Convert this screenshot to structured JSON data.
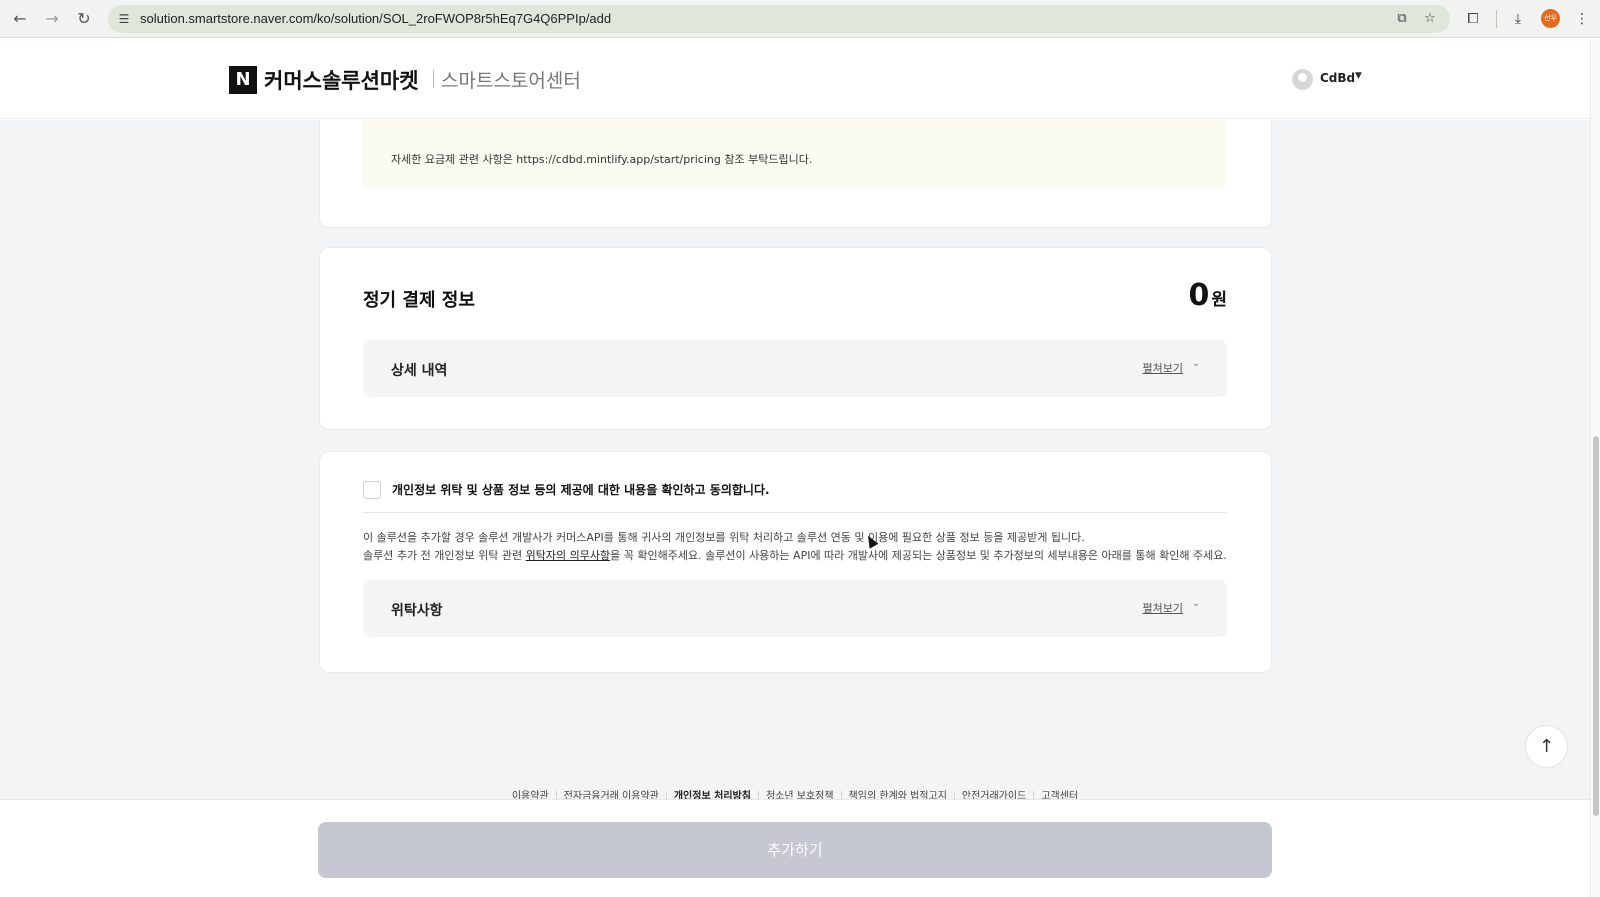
{
  "browser": {
    "url": "solution.smartstore.naver.com/ko/solution/SOL_2roFWOP8r5hEq7G4Q6PPIp/add",
    "icons": [
      "back-icon",
      "forward-icon",
      "reload-icon",
      "site-settings-icon",
      "install-icon",
      "star-icon",
      "extensions-icon",
      "download-icon",
      "menu-icon"
    ],
    "profile_initials": "선우"
  },
  "header": {
    "logo_letter": "N",
    "brand": "커머스솔루션마켓",
    "sub_brand": "스마트스토어센터",
    "user_name": "CdBd"
  },
  "notice": {
    "text": "자세한 요금제 관련 사항은 https://cdbd.mintlify.app/start/pricing 참조 부탁드립니다."
  },
  "payment": {
    "title": "정기 결제 정보",
    "amount": "0",
    "currency": "원",
    "detail_label": "상세 내역",
    "expand_label": "펼쳐보기"
  },
  "consent": {
    "title": "개인정보 위탁 및 상품 정보 등의 제공에 대한 내용을 확인하고 동의합니다.",
    "checked": false,
    "desc_line1": "이 솔루션을 추가할 경우 솔루션 개발사가 커머스API를 통해 귀사의 개인정보를 위탁 처리하고 솔루션 연동 및 이용에 필요한 상품 정보 등을 제공받게 됩니다.",
    "desc_line2_prefix": "솔루션 추가 전 개인정보 위탁 관련 ",
    "desc_line2_link": "위탁자의 의무사항",
    "desc_line2_suffix": "을 꼭 확인해주세요. 솔루션이 사용하는 API에 따라 개발사에 제공되는 상품정보 및 추가정보의 세부내용은 아래를 통해 확인해 주세요.",
    "trust_label": "위탁사항",
    "expand_label": "펼쳐보기"
  },
  "footer": {
    "links": [
      "이용약관",
      "전자금융거래 이용약관",
      "개인정보 처리방침",
      "청소년 보호정책",
      "책임의 한계와 법적고지",
      "안전거래가이드",
      "고객센터"
    ]
  },
  "actions": {
    "add_button": "추가하기"
  }
}
